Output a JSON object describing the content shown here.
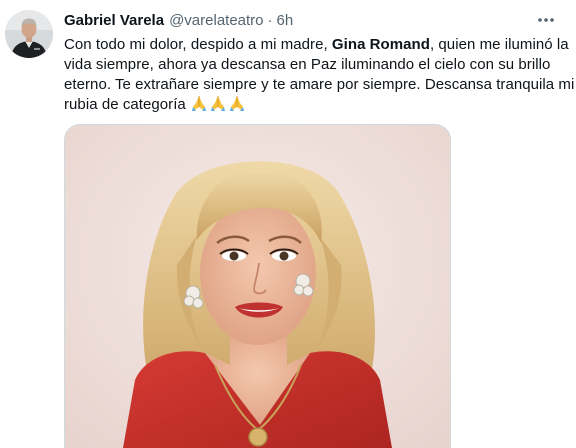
{
  "tweet": {
    "author": {
      "name": "Gabriel Varela",
      "handle": "@varelateatro",
      "avatar_icon": "profile-photo"
    },
    "separator": "·",
    "time": "6h",
    "more_icon": "more-horizontal-icon",
    "text": {
      "line1_before": "Con todo mi dolor, despido a mi madre, ",
      "line1_bold": "Gina Romand",
      "line1_after": ", quien me iluminó la",
      "line2": "vida siempre, ahora ya descansa en Paz iluminando el cielo con su brillo",
      "line3": "eterno. Te extrañare siempre y te amare por siempre. Descansa tranquila mi",
      "line4": "rubia de categoría",
      "emoji": "folded-hands-emoji"
    },
    "media": {
      "type": "photo",
      "description_icon": "portrait-photo"
    }
  },
  "colors": {
    "text_primary": "#0f1419",
    "text_secondary": "#536471",
    "border": "#cfd9de",
    "photo_background": "#f1e3e0",
    "blouse_red": "#c8302c",
    "hair_blonde": "#dcc08a"
  }
}
